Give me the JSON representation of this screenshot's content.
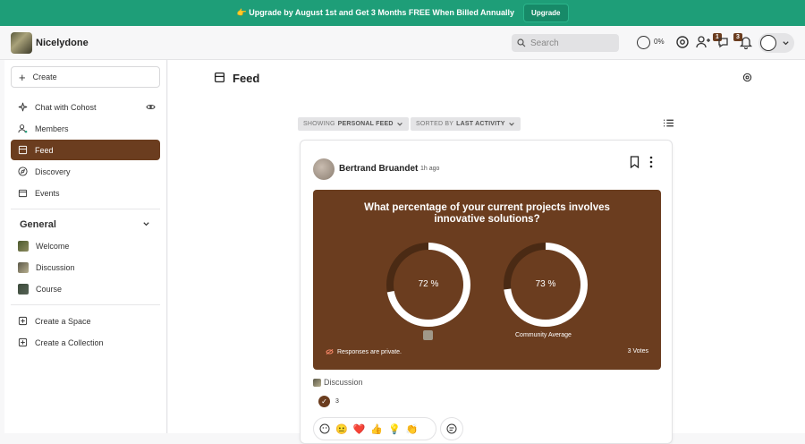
{
  "banner": {
    "text": "👉 Upgrade by August 1st and Get 3 Months FREE When Billed Annually",
    "button": "Upgrade"
  },
  "topbar": {
    "brand": "Nicelydone",
    "search_placeholder": "Search",
    "progress_pct": "0%",
    "invites_badge": "1",
    "messages_badge": "3"
  },
  "sidebar": {
    "create_label": "Create",
    "items": [
      {
        "label": "Chat with Cohost",
        "icon": "sparkle-icon"
      },
      {
        "label": "Members",
        "icon": "members-icon"
      },
      {
        "label": "Feed",
        "icon": "feed-icon",
        "active": true
      },
      {
        "label": "Discovery",
        "icon": "compass-icon"
      },
      {
        "label": "Events",
        "icon": "calendar-icon"
      }
    ],
    "section_title": "General",
    "spaces": [
      {
        "label": "Welcome",
        "color": "#4c5a2e"
      },
      {
        "label": "Discussion",
        "color": "#5b5848"
      },
      {
        "label": "Course",
        "color": "#3b4a3a"
      }
    ],
    "create_space": "Create a Space",
    "create_collection": "Create a Collection"
  },
  "main": {
    "title": "Feed",
    "filter_showing": "SHOWING",
    "filter_showing_value": "PERSONAL FEED",
    "filter_sorted": "SORTED BY",
    "filter_sorted_value": "LAST ACTIVITY"
  },
  "post": {
    "author": "Bertrand Bruandet",
    "time": "1h ago",
    "poll_question": "What percentage of your current projects involves innovative solutions?",
    "user_value_label": "72 %",
    "user_value": 72,
    "community_value_label": "73 %",
    "community_value": 73,
    "community_label": "Community Average",
    "responses_note": "Responses are private.",
    "votes": "3 Votes",
    "space": "Discussion",
    "check_count": "3",
    "reactions": [
      "😐",
      "❤️",
      "👍",
      "💡",
      "👏"
    ]
  },
  "colors": {
    "brand": "#6b3d1f",
    "banner": "#1e9e78"
  }
}
